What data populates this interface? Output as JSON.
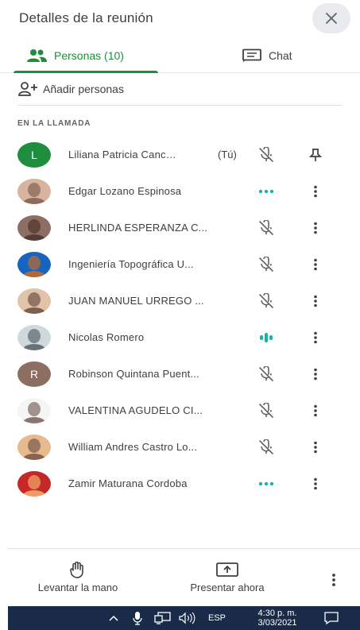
{
  "header": {
    "title": "Detalles de la reunión"
  },
  "tabs": [
    {
      "label": "Personas (10)",
      "active": true
    },
    {
      "label": "Chat",
      "active": false
    }
  ],
  "add_people": {
    "label": "Añadir personas"
  },
  "section": {
    "label": "EN LA LLAMADA"
  },
  "participants": [
    {
      "name": "Liliana Patricia Canc…",
      "tag": "(Tú)",
      "avatar": {
        "type": "initial",
        "initial": "L",
        "color": "#1e8e3e"
      },
      "status": "muted",
      "action": "pin"
    },
    {
      "name": "Edgar Lozano Espinosa",
      "tag": "",
      "avatar": {
        "type": "photo"
      },
      "status": "idle-dots",
      "action": "more"
    },
    {
      "name": "HERLINDA ESPERANZA C...",
      "tag": "",
      "avatar": {
        "type": "photo"
      },
      "status": "muted",
      "action": "more"
    },
    {
      "name": "Ingeniería Topográfica U...",
      "tag": "",
      "avatar": {
        "type": "photo"
      },
      "status": "muted",
      "action": "more"
    },
    {
      "name": "JUAN MANUEL URREGO ...",
      "tag": "",
      "avatar": {
        "type": "photo"
      },
      "status": "muted",
      "action": "more"
    },
    {
      "name": "Nicolas Romero",
      "tag": "",
      "avatar": {
        "type": "photo"
      },
      "status": "speaking",
      "action": "more"
    },
    {
      "name": "Robinson Quintana Puent...",
      "tag": "",
      "avatar": {
        "type": "initial",
        "initial": "R",
        "color": "#8d6e63"
      },
      "status": "muted",
      "action": "more"
    },
    {
      "name": "VALENTINA AGUDELO CI...",
      "tag": "",
      "avatar": {
        "type": "photo"
      },
      "status": "muted",
      "action": "more"
    },
    {
      "name": "William Andres Castro Lo...",
      "tag": "",
      "avatar": {
        "type": "photo"
      },
      "status": "muted",
      "action": "more"
    },
    {
      "name": "Zamir Maturana Cordoba",
      "tag": "",
      "avatar": {
        "type": "photo"
      },
      "status": "idle-dots",
      "action": "more"
    }
  ],
  "footer": {
    "raise_hand_label": "Levantar la mano",
    "present_label": "Presentar ahora"
  },
  "taskbar": {
    "language": "ESP",
    "time": "4:30 p. m.",
    "date": "3/03/2021"
  },
  "colors": {
    "accent": "#1e8e3e",
    "taskbar": "#1a2b4a"
  }
}
